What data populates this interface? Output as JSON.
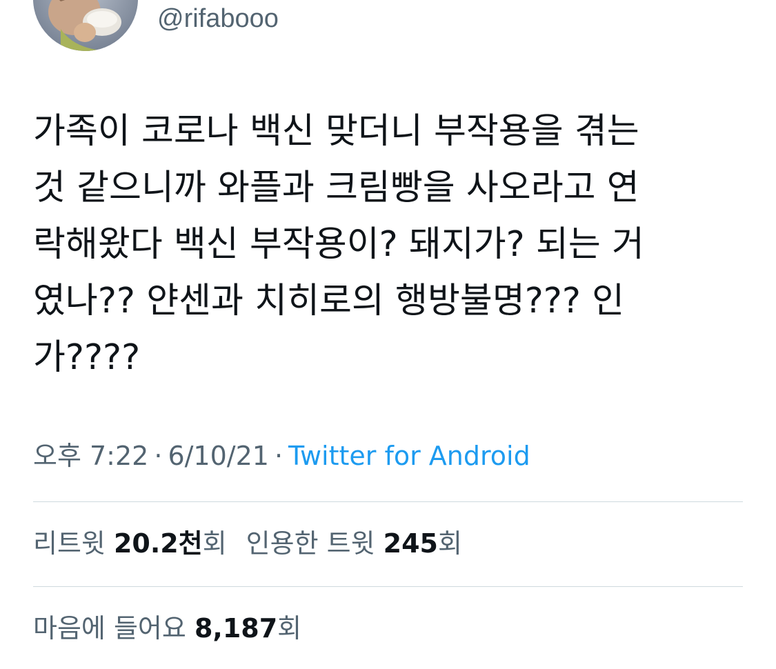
{
  "author": {
    "handle": "@rifabooo",
    "avatar_icon": "profile-photo"
  },
  "tweet": {
    "lines": [
      "가족이 코로나 백신 맞더니 부작용을 겪는",
      "것 같으니까 와플과 크림빵을 사오라고 연",
      "락해왔다 백신 부작용이? 돼지가? 되는 거",
      "였나?? 얀센과 치히로의 행방불명??? 인",
      "가????"
    ]
  },
  "meta": {
    "time": "오후 7:22",
    "separator": "·",
    "date": "6/10/21",
    "source": "Twitter for Android"
  },
  "stats": {
    "retweets_label": "리트윗",
    "retweets_value": "20.2천",
    "retweets_unit": "회",
    "quotes_label": "인용한 트윗",
    "quotes_value": "245",
    "quotes_unit": "회",
    "likes_label": "마음에 들어요",
    "likes_value": "8,187",
    "likes_unit": "회"
  },
  "colors": {
    "text": "#0f1419",
    "secondary": "#536471",
    "link": "#1d9bf0",
    "divider": "#cfd9de"
  }
}
